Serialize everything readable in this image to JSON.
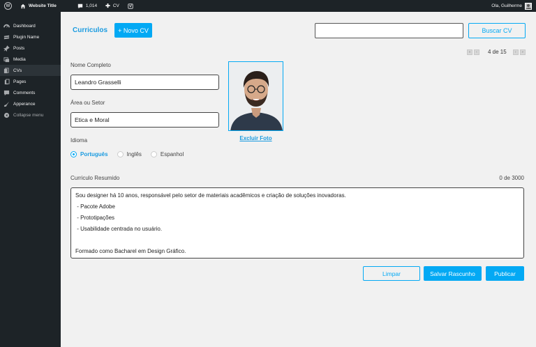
{
  "adminbar": {
    "site_title": "Website Title",
    "comments_count": "1,014",
    "new_label": "CV",
    "greeting": "Ola, Guilherme"
  },
  "sidebar": {
    "items": [
      {
        "label": "Dashboard",
        "icon": "dashboard-icon"
      },
      {
        "label": "Plugin Name",
        "icon": "plugin-icon"
      },
      {
        "label": "Posts",
        "icon": "pin-icon"
      },
      {
        "label": "Media",
        "icon": "media-icon"
      },
      {
        "label": "CVs",
        "icon": "document-icon"
      },
      {
        "label": "Pages",
        "icon": "pages-icon"
      },
      {
        "label": "Comments",
        "icon": "comment-icon"
      },
      {
        "label": "Apperance",
        "icon": "brush-icon"
      },
      {
        "label": "Collapse menu",
        "icon": "collapse-icon"
      }
    ],
    "active_index": 4
  },
  "header": {
    "title": "Curriculos",
    "new_button": "+ Novo CV",
    "search_value": "",
    "search_button": "Buscar CV"
  },
  "pager": {
    "text": "4 de 15"
  },
  "form": {
    "name_label": "Nome Completo",
    "name_value": "Leandro Grasselli",
    "area_label": "Área ou Setor",
    "area_value": "Etica e Moral",
    "language_label": "Idioma",
    "languages": [
      "Português",
      "Inglês",
      "Espanhol"
    ],
    "selected_language": "Português",
    "delete_photo": "Excluir Foto",
    "summary_label": "Curriculo Resumido",
    "char_counter": "0 de 3000",
    "summary_lines": [
      "Sou designer há 10 anos, responsável pelo setor de materiais acadêmicos e criação de soluções inovadoras.",
      " - Pacote Adobe",
      " - Prototipações",
      " - Usabilidade centrada no usuário.",
      "",
      "Formado como Bacharel em Design Gráfico."
    ]
  },
  "actions": {
    "clear": "Limpar",
    "draft": "Salvar Rascunho",
    "publish": "Publicar"
  },
  "colors": {
    "accent": "#03a9f4",
    "admin_bg": "#1d2327",
    "page_bg": "#f1f1f1"
  }
}
